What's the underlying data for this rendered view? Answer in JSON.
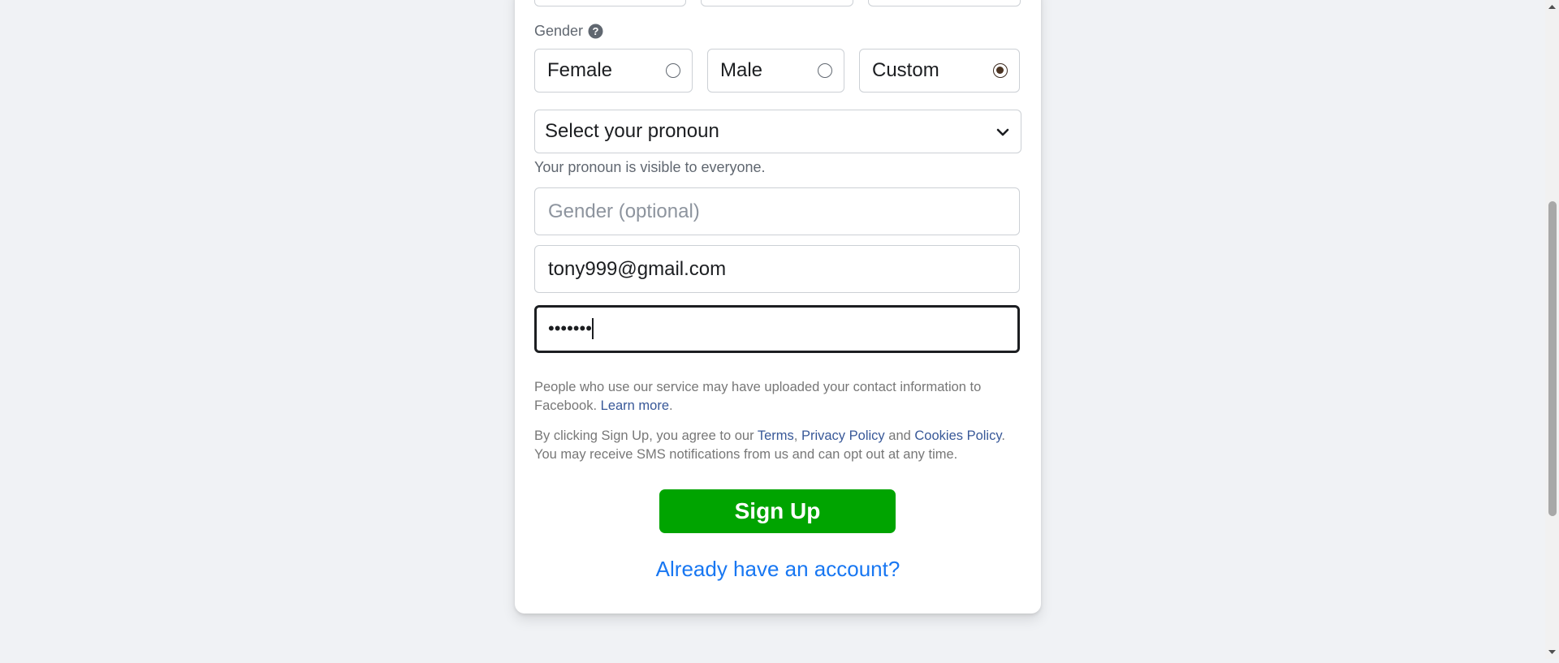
{
  "form": {
    "gender_label": "Gender",
    "gender_options": [
      {
        "label": "Female",
        "checked": false
      },
      {
        "label": "Male",
        "checked": false
      },
      {
        "label": "Custom",
        "checked": true
      }
    ],
    "pronoun_select": {
      "selected": "Select your pronoun"
    },
    "pronoun_helper": "Your pronoun is visible to everyone.",
    "gender_optional": {
      "placeholder": "Gender (optional)",
      "value": ""
    },
    "email": {
      "value": "tony999@gmail.com"
    },
    "password": {
      "masked": "•••••••"
    },
    "contact_notice": {
      "text": "People who use our service may have uploaded your contact information to Facebook.",
      "link": "Learn more",
      "end": "."
    },
    "terms_notice": {
      "prefix": "By clicking Sign Up, you agree to our",
      "terms": "Terms",
      "comma": ",",
      "privacy": "Privacy Policy",
      "and": "and",
      "cookies": "Cookies Policy",
      "suffix": ". You may receive SMS notifications from us and can opt out at any time."
    },
    "signup_label": "Sign Up",
    "already_label": "Already have an account?"
  },
  "colors": {
    "background": "#f0f2f5",
    "signup_green": "#00a400",
    "link_blue": "#385898",
    "already_blue": "#1877f2"
  },
  "icons": {
    "help": "question-circle-icon",
    "dropdown": "chevron-down-icon",
    "scroll_up": "triangle-up-icon",
    "scroll_down": "triangle-down-icon"
  }
}
